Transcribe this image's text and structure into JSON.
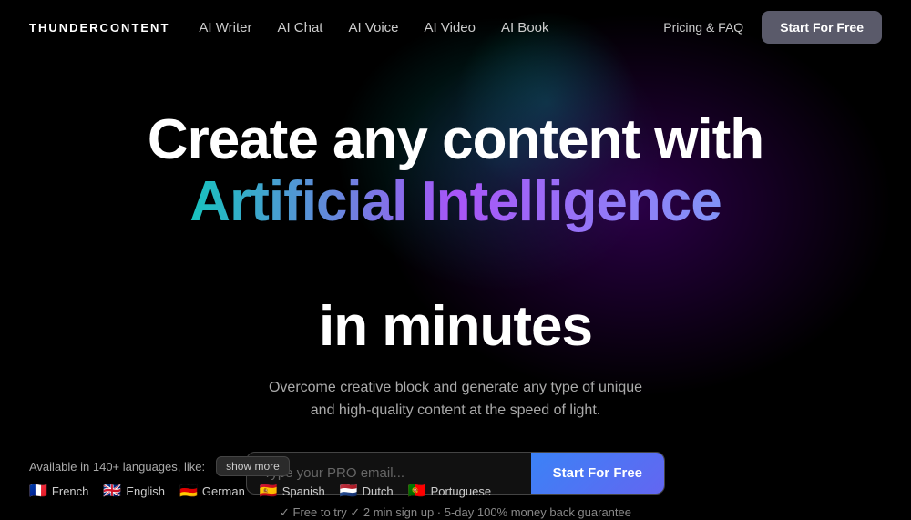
{
  "logo": {
    "text": "THUNDERCONTENT"
  },
  "nav": {
    "links": [
      {
        "label": "AI Writer",
        "id": "ai-writer"
      },
      {
        "label": "AI Chat",
        "id": "ai-chat"
      },
      {
        "label": "AI Voice",
        "id": "ai-voice"
      },
      {
        "label": "AI Video",
        "id": "ai-video"
      },
      {
        "label": "AI Book",
        "id": "ai-book"
      }
    ],
    "pricing_label": "Pricing & FAQ",
    "cta_label": "Start For Free"
  },
  "hero": {
    "title_line1": "Create any content with",
    "title_gradient": "Artificial Intelligence",
    "title_line3": "in minutes",
    "subtitle": "Overcome creative block and generate any type of unique and high-quality content at the speed of light.",
    "email_placeholder": "Type your PRO email...",
    "cta_label": "Start For Free",
    "guarantee": "✓ Free to try ✓ 2 min sign up · 5-day 100% money back guarantee"
  },
  "languages": {
    "label": "Available in 140+ languages, like:",
    "show_more": "show more",
    "items": [
      {
        "flag": "🇫🇷",
        "name": "French"
      },
      {
        "flag": "🇬🇧",
        "name": "English"
      },
      {
        "flag": "🇩🇪",
        "name": "German"
      },
      {
        "flag": "🇪🇸",
        "name": "Spanish"
      },
      {
        "flag": "🇳🇱",
        "name": "Dutch"
      },
      {
        "flag": "🇵🇹",
        "name": "Portuguese"
      }
    ]
  }
}
